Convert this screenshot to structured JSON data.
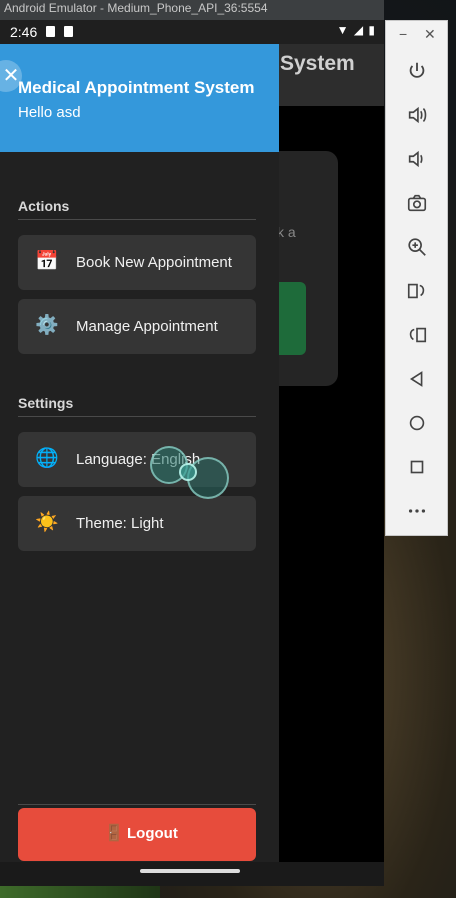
{
  "window": {
    "title": "Android Emulator - Medium_Phone_API_36:5554"
  },
  "status_bar": {
    "time": "2:46"
  },
  "background_app": {
    "title": "System",
    "colon": ":",
    "fragment": "k a"
  },
  "drawer": {
    "close_glyph": "✕",
    "title": "Medical Appointment System",
    "greeting": "Hello asd",
    "actions_title": "Actions",
    "actions": [
      {
        "icon": "calendar-icon",
        "glyph": "📅",
        "label": "Book New Appointment"
      },
      {
        "icon": "gear-icon",
        "glyph": "⚙️",
        "label": "Manage Appointment"
      }
    ],
    "settings_title": "Settings",
    "settings": [
      {
        "icon": "globe-icon",
        "glyph": "🌐",
        "label": "Language: English"
      },
      {
        "icon": "sun-icon",
        "glyph": "☀️",
        "label": "Theme: Light"
      }
    ],
    "logout": {
      "icon": "door-icon",
      "glyph": "🚪",
      "label": "Logout"
    }
  },
  "colors": {
    "header_blue": "#3498db",
    "drawer_bg": "#212121",
    "item_bg": "#353535",
    "logout_red": "#e74c3c"
  },
  "side_panel": {
    "minimize": "−",
    "close": "✕",
    "buttons": [
      "power-icon",
      "volume-up-icon",
      "volume-down-icon",
      "camera-icon",
      "zoom-icon",
      "rotate-left-icon",
      "rotate-right-icon",
      "back-icon",
      "home-icon",
      "overview-icon",
      "more-icon"
    ]
  }
}
